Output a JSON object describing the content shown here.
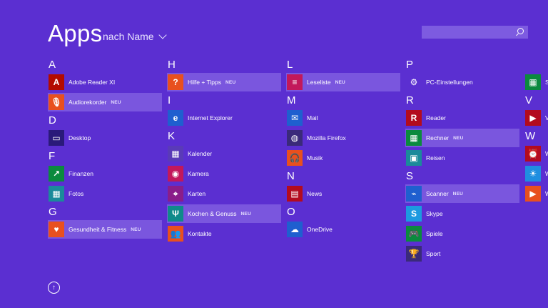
{
  "header": {
    "title": "Apps",
    "sort_label": "nach Name"
  },
  "search": {
    "placeholder": ""
  },
  "neu_label": "NEU",
  "columns": [
    {
      "groups": [
        {
          "letter": "A",
          "apps": [
            {
              "name": "Adobe Reader XI",
              "icon": "adobe-reader-icon",
              "color": "#b30b00",
              "glyph": "A"
            },
            {
              "name": "Audiorekorder",
              "icon": "microphone-icon",
              "color": "#e8501e",
              "glyph": "🎙",
              "neu": true
            }
          ]
        },
        {
          "letter": "D",
          "apps": [
            {
              "name": "Desktop",
              "icon": "desktop-icon",
              "color": "#2a1a7a",
              "glyph": "▭"
            }
          ]
        },
        {
          "letter": "F",
          "apps": [
            {
              "name": "Finanzen",
              "icon": "finance-icon",
              "color": "#0b8a3e",
              "glyph": "↗"
            },
            {
              "name": "Fotos",
              "icon": "photos-icon",
              "color": "#1b8a9a",
              "glyph": "▦"
            }
          ]
        },
        {
          "letter": "G",
          "apps": [
            {
              "name": "Gesundheit & Fitness",
              "icon": "health-heart-icon",
              "color": "#e8501e",
              "glyph": "♥",
              "neu": true
            }
          ]
        }
      ]
    },
    {
      "groups": [
        {
          "letter": "H",
          "apps": [
            {
              "name": "Hilfe + Tipps",
              "icon": "help-icon",
              "color": "#e8501e",
              "glyph": "?",
              "neu": true
            }
          ]
        },
        {
          "letter": "I",
          "apps": [
            {
              "name": "Internet Explorer",
              "icon": "internet-explorer-icon",
              "color": "#1f5fcf",
              "glyph": "e"
            }
          ]
        },
        {
          "letter": "K",
          "apps": [
            {
              "name": "Kalender",
              "icon": "calendar-icon",
              "color": "#5a3ab8",
              "glyph": "▦"
            },
            {
              "name": "Kamera",
              "icon": "camera-icon",
              "color": "#c2185b",
              "glyph": "◉"
            },
            {
              "name": "Karten",
              "icon": "map-icon",
              "color": "#8a1d8a",
              "glyph": "⌖"
            },
            {
              "name": "Kochen & Genuss",
              "icon": "food-icon",
              "color": "#0f8a8a",
              "glyph": "Ψ",
              "neu": true
            },
            {
              "name": "Kontakte",
              "icon": "contacts-icon",
              "color": "#e8501e",
              "glyph": "👥"
            }
          ]
        }
      ]
    },
    {
      "groups": [
        {
          "letter": "L",
          "apps": [
            {
              "name": "Leseliste",
              "icon": "reading-list-icon",
              "color": "#c2185b",
              "glyph": "≡",
              "neu": true
            }
          ]
        },
        {
          "letter": "M",
          "apps": [
            {
              "name": "Mail",
              "icon": "mail-icon",
              "color": "#1f5fcf",
              "glyph": "✉"
            },
            {
              "name": "Mozilla Firefox",
              "icon": "firefox-icon",
              "color": "#3a2a7a",
              "glyph": "◍"
            },
            {
              "name": "Musik",
              "icon": "music-icon",
              "color": "#e8501e",
              "glyph": "🎧"
            }
          ]
        },
        {
          "letter": "N",
          "apps": [
            {
              "name": "News",
              "icon": "news-icon",
              "color": "#b30b1e",
              "glyph": "▤"
            }
          ]
        },
        {
          "letter": "O",
          "apps": [
            {
              "name": "OneDrive",
              "icon": "onedrive-icon",
              "color": "#1f5fcf",
              "glyph": "☁"
            }
          ]
        }
      ]
    },
    {
      "groups": [
        {
          "letter": "P",
          "apps": [
            {
              "name": "PC-Einstellungen",
              "icon": "gear-icon",
              "color": "#5b2fd1",
              "glyph": "⚙"
            }
          ]
        },
        {
          "letter": "R",
          "apps": [
            {
              "name": "Reader",
              "icon": "reader-icon",
              "color": "#b30b1e",
              "glyph": "R"
            },
            {
              "name": "Rechner",
              "icon": "calculator-icon",
              "color": "#0b8a3e",
              "glyph": "▦",
              "neu": true
            },
            {
              "name": "Reisen",
              "icon": "travel-icon",
              "color": "#1b8a9a",
              "glyph": "▣"
            }
          ]
        },
        {
          "letter": "S",
          "apps": [
            {
              "name": "Scanner",
              "icon": "scanner-icon",
              "color": "#1f5fcf",
              "glyph": "⌁",
              "neu": true
            },
            {
              "name": "Skype",
              "icon": "skype-icon",
              "color": "#1c9ae0",
              "glyph": "S"
            },
            {
              "name": "Spiele",
              "icon": "games-icon",
              "color": "#0b8a3e",
              "glyph": "🎮"
            },
            {
              "name": "Sport",
              "icon": "trophy-icon",
              "color": "#3a2a7a",
              "glyph": "🏆"
            }
          ]
        }
      ]
    },
    {
      "groups": [
        {
          "letter": "",
          "apps": [
            {
              "name": "S",
              "icon": "store-icon",
              "color": "#0b8a3e",
              "glyph": "▦"
            }
          ]
        },
        {
          "letter": "V",
          "apps": [
            {
              "name": "V",
              "icon": "video-icon",
              "color": "#b30b1e",
              "glyph": "▶"
            }
          ]
        },
        {
          "letter": "W",
          "apps": [
            {
              "name": "W",
              "icon": "alarm-icon",
              "color": "#b30b1e",
              "glyph": "⏰"
            },
            {
              "name": "W",
              "icon": "weather-icon",
              "color": "#1f8ee0",
              "glyph": "☀"
            },
            {
              "name": "W",
              "icon": "video-icon",
              "color": "#e8501e",
              "glyph": "▶"
            }
          ]
        }
      ]
    }
  ]
}
